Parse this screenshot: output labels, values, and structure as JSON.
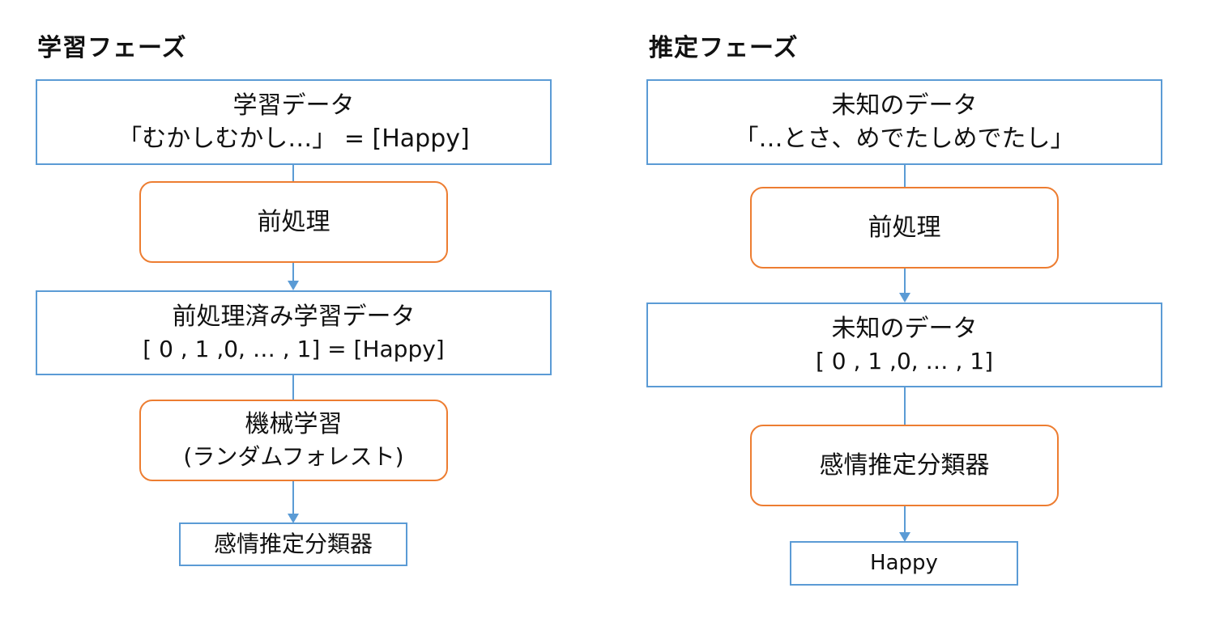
{
  "left": {
    "title": "学習フェーズ",
    "training_data": {
      "line1": "学習データ",
      "line2": "「むかしむかし…」 = [Happy]"
    },
    "preprocess": "前処理",
    "preprocessed": {
      "line1": "前処理済み学習データ",
      "line2": "[ 0 , 1 ,0, … , 1] = [Happy]"
    },
    "ml": {
      "line1": "機械学習",
      "line2": "(ランダムフォレスト)"
    },
    "classifier": "感情推定分類器"
  },
  "right": {
    "title": "推定フェーズ",
    "unknown_data": {
      "line1": "未知のデータ",
      "line2": "「…とさ、めでたしめでたし」"
    },
    "preprocess": "前処理",
    "unknown_vector": {
      "line1": "未知のデータ",
      "line2": "[ 0 , 1 ,0, … , 1]"
    },
    "classifier": "感情推定分類器",
    "output": "Happy"
  },
  "colors": {
    "box_border": "#5b9bd5",
    "process_border": "#ed7d31",
    "connector": "#5b9bd5"
  }
}
